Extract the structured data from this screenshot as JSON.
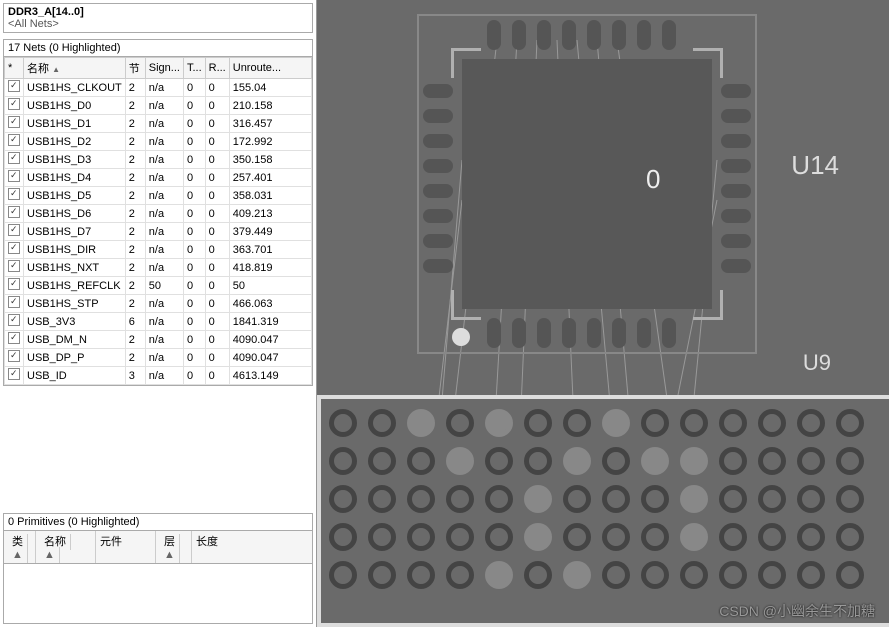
{
  "top": {
    "line1": "DDR3_A[14..0]",
    "line2": "<All Nets>"
  },
  "nets_section": {
    "title": "17 Nets (0 Highlighted)"
  },
  "net_headers": {
    "star": "*",
    "name": "名称",
    "node": "节",
    "sign": "Sign...",
    "t": "T...",
    "r": "R...",
    "unroute": "Unroute..."
  },
  "nets": [
    {
      "name": "USB1HS_CLKOUT",
      "n": "2",
      "sig": "n/a",
      "t": "0",
      "r": "0",
      "un": "155.04"
    },
    {
      "name": "USB1HS_D0",
      "n": "2",
      "sig": "n/a",
      "t": "0",
      "r": "0",
      "un": "210.158"
    },
    {
      "name": "USB1HS_D1",
      "n": "2",
      "sig": "n/a",
      "t": "0",
      "r": "0",
      "un": "316.457"
    },
    {
      "name": "USB1HS_D2",
      "n": "2",
      "sig": "n/a",
      "t": "0",
      "r": "0",
      "un": "172.992"
    },
    {
      "name": "USB1HS_D3",
      "n": "2",
      "sig": "n/a",
      "t": "0",
      "r": "0",
      "un": "350.158"
    },
    {
      "name": "USB1HS_D4",
      "n": "2",
      "sig": "n/a",
      "t": "0",
      "r": "0",
      "un": "257.401"
    },
    {
      "name": "USB1HS_D5",
      "n": "2",
      "sig": "n/a",
      "t": "0",
      "r": "0",
      "un": "358.031"
    },
    {
      "name": "USB1HS_D6",
      "n": "2",
      "sig": "n/a",
      "t": "0",
      "r": "0",
      "un": "409.213"
    },
    {
      "name": "USB1HS_D7",
      "n": "2",
      "sig": "n/a",
      "t": "0",
      "r": "0",
      "un": "379.449"
    },
    {
      "name": "USB1HS_DIR",
      "n": "2",
      "sig": "n/a",
      "t": "0",
      "r": "0",
      "un": "363.701"
    },
    {
      "name": "USB1HS_NXT",
      "n": "2",
      "sig": "n/a",
      "t": "0",
      "r": "0",
      "un": "418.819"
    },
    {
      "name": "USB1HS_REFCLK",
      "n": "2",
      "sig": "50",
      "t": "0",
      "r": "0",
      "un": "50"
    },
    {
      "name": "USB1HS_STP",
      "n": "2",
      "sig": "n/a",
      "t": "0",
      "r": "0",
      "un": "466.063"
    },
    {
      "name": "USB_3V3",
      "n": "6",
      "sig": "n/a",
      "t": "0",
      "r": "0",
      "un": "1841.319"
    },
    {
      "name": "USB_DM_N",
      "n": "2",
      "sig": "n/a",
      "t": "0",
      "r": "0",
      "un": "4090.047"
    },
    {
      "name": "USB_DP_P",
      "n": "2",
      "sig": "n/a",
      "t": "0",
      "r": "0",
      "un": "4090.047"
    },
    {
      "name": "USB_ID",
      "n": "3",
      "sig": "n/a",
      "t": "0",
      "r": "0",
      "un": "4613.149"
    }
  ],
  "prim_section": {
    "title": "0 Primitives (0 Highlighted)"
  },
  "prim_headers": {
    "type": "类",
    "name": "名称",
    "comp": "元件",
    "layer": "层",
    "len": "长度"
  },
  "canvas": {
    "chip_text": "0",
    "u14": "U14",
    "u9": "U9"
  },
  "watermark": "CSDN @小幽余生不加糖"
}
